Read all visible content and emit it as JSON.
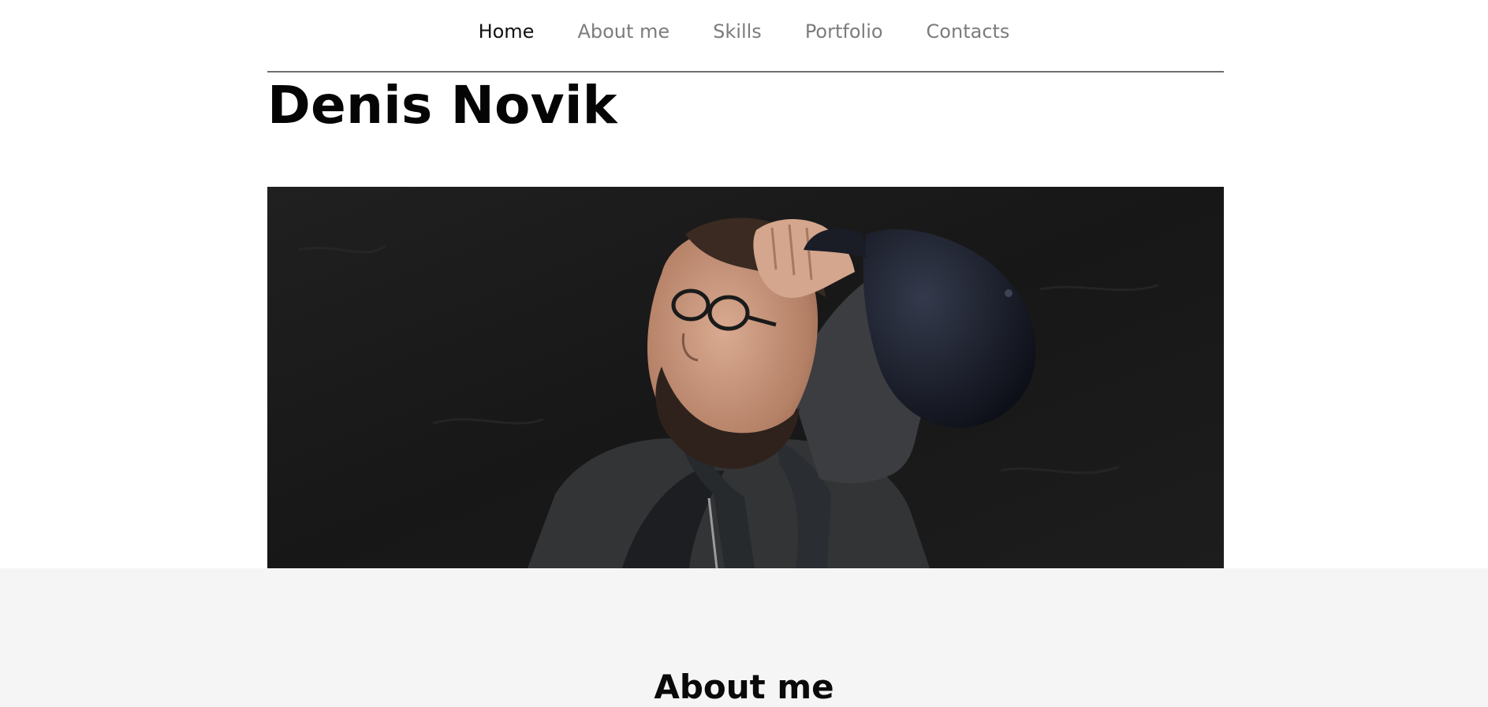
{
  "nav": {
    "items": [
      {
        "label": "Home",
        "active": true
      },
      {
        "label": "About me",
        "active": false
      },
      {
        "label": "Skills",
        "active": false
      },
      {
        "label": "Portfolio",
        "active": false
      },
      {
        "label": "Contacts",
        "active": false
      }
    ]
  },
  "hero": {
    "title": "Denis Novik",
    "photo": "portrait-photo"
  },
  "about": {
    "title": "About me"
  },
  "colors": {
    "nav_active": "#111111",
    "nav_inactive": "#7c7c7c",
    "divider": "#6e6e6e",
    "section_bg": "#f5f5f5",
    "photo_bg": "#1a1a1a"
  }
}
